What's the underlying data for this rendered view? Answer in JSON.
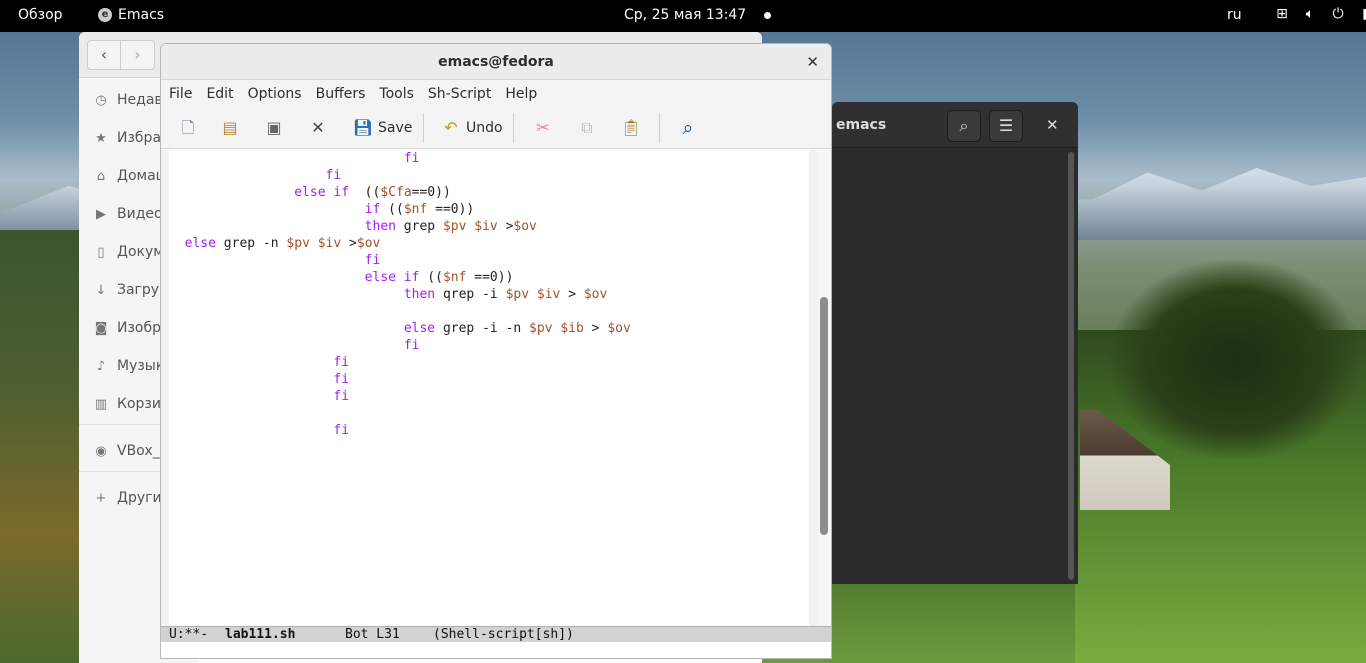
{
  "topbar": {
    "overview": "Обзор",
    "app_name": "Emacs",
    "clock": "Ср, 25 мая  13:47",
    "lang": "ru",
    "tray_icons": [
      "network-icon",
      "volume-icon",
      "power-icon",
      "battery-icon"
    ]
  },
  "files": {
    "sidebar": [
      {
        "icon": "clock-icon",
        "label": "Недав"
      },
      {
        "icon": "star-icon",
        "label": "Избра"
      },
      {
        "icon": "home-icon",
        "label": "Домаш"
      },
      {
        "icon": "video-icon",
        "label": "Видео"
      },
      {
        "icon": "document-icon",
        "label": "Докум"
      },
      {
        "icon": "download-icon",
        "label": "Загруз"
      },
      {
        "icon": "camera-icon",
        "label": "Изобр"
      },
      {
        "icon": "music-icon",
        "label": "Музык"
      },
      {
        "icon": "trash-icon",
        "label": "Корзин"
      },
      {
        "icon": "disc-icon",
        "label": "VBox_G"
      },
      {
        "icon": "plus-icon",
        "label": "Други"
      }
    ]
  },
  "terminal": {
    "title": "emacs"
  },
  "emacs": {
    "title": "emacs@fedora",
    "menu": [
      "File",
      "Edit",
      "Options",
      "Buffers",
      "Tools",
      "Sh-Script",
      "Help"
    ],
    "toolbar": {
      "save_label": "Save",
      "undo_label": "Undo"
    },
    "code_lines": [
      [
        {
          "t": "                              "
        },
        {
          "t": "fi",
          "c": "kw"
        }
      ],
      [
        {
          "t": "                    "
        },
        {
          "t": "fi",
          "c": "kw"
        }
      ],
      [
        {
          "t": "                "
        },
        {
          "t": "else if",
          "c": "kw"
        },
        {
          "t": "  (("
        },
        {
          "t": "$Cfa",
          "c": "vr"
        },
        {
          "t": "==0))"
        }
      ],
      [
        {
          "t": "                         "
        },
        {
          "t": "if",
          "c": "kw"
        },
        {
          "t": " (("
        },
        {
          "t": "$nf",
          "c": "vr"
        },
        {
          "t": " ==0))"
        }
      ],
      [
        {
          "t": "                         "
        },
        {
          "t": "then",
          "c": "kw"
        },
        {
          "t": " grep "
        },
        {
          "t": "$pv",
          "c": "vr"
        },
        {
          "t": " "
        },
        {
          "t": "$iv",
          "c": "vr"
        },
        {
          "t": " >"
        },
        {
          "t": "$ov",
          "c": "vr"
        }
      ],
      [
        {
          "t": "  "
        },
        {
          "t": "else",
          "c": "kw"
        },
        {
          "t": " grep -n "
        },
        {
          "t": "$pv",
          "c": "vr"
        },
        {
          "t": " "
        },
        {
          "t": "$iv",
          "c": "vr"
        },
        {
          "t": " >"
        },
        {
          "t": "$ov",
          "c": "vr"
        }
      ],
      [
        {
          "t": "                         "
        },
        {
          "t": "fi",
          "c": "kw"
        }
      ],
      [
        {
          "t": "                         "
        },
        {
          "t": "else if",
          "c": "kw"
        },
        {
          "t": " (("
        },
        {
          "t": "$nf",
          "c": "vr"
        },
        {
          "t": " ==0))"
        }
      ],
      [
        {
          "t": "                              "
        },
        {
          "t": "then",
          "c": "kw"
        },
        {
          "t": " qrep -i "
        },
        {
          "t": "$pv",
          "c": "vr"
        },
        {
          "t": " "
        },
        {
          "t": "$iv",
          "c": "vr"
        },
        {
          "t": " > "
        },
        {
          "t": "$ov",
          "c": "vr"
        }
      ],
      [
        {
          "t": ""
        }
      ],
      [
        {
          "t": "                              "
        },
        {
          "t": "else",
          "c": "kw"
        },
        {
          "t": " grep -i -n "
        },
        {
          "t": "$pv",
          "c": "vr"
        },
        {
          "t": " "
        },
        {
          "t": "$ib",
          "c": "vr"
        },
        {
          "t": " > "
        },
        {
          "t": "$ov",
          "c": "vr"
        }
      ],
      [
        {
          "t": "                              "
        },
        {
          "t": "fi",
          "c": "kw"
        }
      ],
      [
        {
          "t": "                     "
        },
        {
          "t": "fi",
          "c": "kw"
        }
      ],
      [
        {
          "t": "                     "
        },
        {
          "t": "fi",
          "c": "kw"
        }
      ],
      [
        {
          "t": "                     "
        },
        {
          "t": "fi",
          "c": "kw"
        }
      ],
      [
        {
          "t": ""
        }
      ],
      [
        {
          "t": "                     "
        },
        {
          "t": "fi",
          "c": "kw"
        }
      ]
    ],
    "modeline": {
      "status": "U:**-",
      "buffer": "lab111.sh",
      "position": "Bot L31",
      "mode": "(Shell-script[sh])"
    }
  }
}
